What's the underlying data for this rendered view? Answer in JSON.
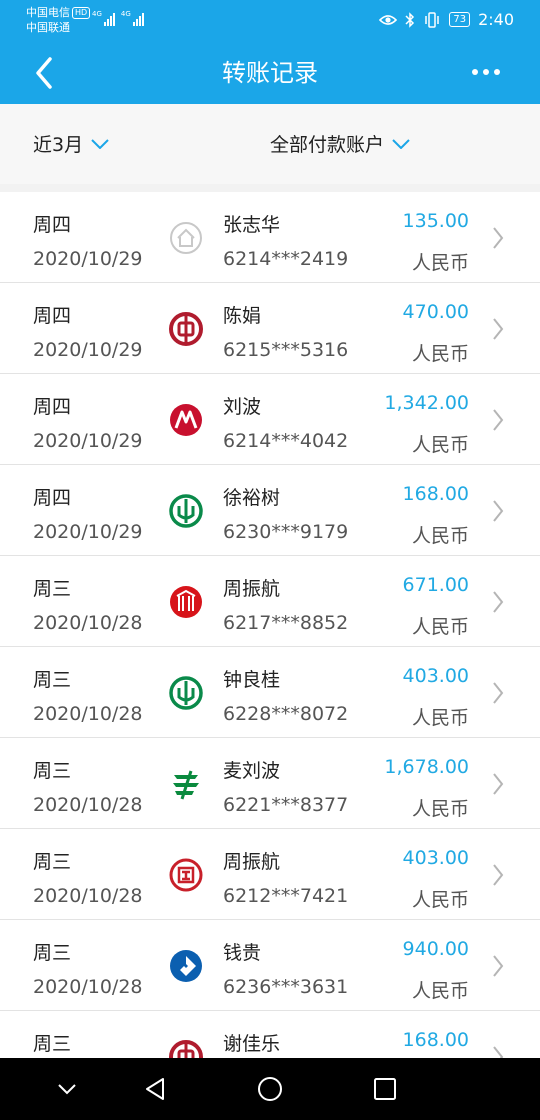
{
  "status_bar": {
    "carrier_1": "中国电信",
    "carrier_1_badge": "HD",
    "carrier_2": "中国联通",
    "network_1": "4G",
    "network_2": "4G",
    "battery": "73",
    "time": "2:40"
  },
  "header": {
    "title": "转账记录"
  },
  "filters": {
    "period": "近3月",
    "account": "全部付款账户"
  },
  "transactions": [
    {
      "weekday": "周四",
      "date": "2020/10/29",
      "name": "张志华",
      "account": "6214***2419",
      "amount": "135.00",
      "currency": "人民币",
      "bank_icon": "house-bank-icon",
      "color": "#c8c8c8"
    },
    {
      "weekday": "周四",
      "date": "2020/10/29",
      "name": "陈娟",
      "account": "6215***5316",
      "amount": "470.00",
      "currency": "人民币",
      "bank_icon": "boc-icon",
      "color": "#b01c2e"
    },
    {
      "weekday": "周四",
      "date": "2020/10/29",
      "name": "刘波",
      "account": "6214***4042",
      "amount": "1,342.00",
      "currency": "人民币",
      "bank_icon": "cmb-icon",
      "color": "#c8102e"
    },
    {
      "weekday": "周四",
      "date": "2020/10/29",
      "name": "徐裕树",
      "account": "6230***9179",
      "amount": "168.00",
      "currency": "人民币",
      "bank_icon": "abc-icon",
      "color": "#0a8a4a"
    },
    {
      "weekday": "周三",
      "date": "2020/10/28",
      "name": "周振航",
      "account": "6217***8852",
      "amount": "671.00",
      "currency": "人民币",
      "bank_icon": "citic-icon",
      "color": "#d7141a"
    },
    {
      "weekday": "周三",
      "date": "2020/10/28",
      "name": "钟良桂",
      "account": "6228***8072",
      "amount": "403.00",
      "currency": "人民币",
      "bank_icon": "abc-icon",
      "color": "#0a8a4a"
    },
    {
      "weekday": "周三",
      "date": "2020/10/28",
      "name": "麦刘波",
      "account": "6221***8377",
      "amount": "1,678.00",
      "currency": "人民币",
      "bank_icon": "postal-icon",
      "color": "#0a8a3e"
    },
    {
      "weekday": "周三",
      "date": "2020/10/28",
      "name": "周振航",
      "account": "6212***7421",
      "amount": "403.00",
      "currency": "人民币",
      "bank_icon": "icbc-icon",
      "color": "#c8202a"
    },
    {
      "weekday": "周三",
      "date": "2020/10/28",
      "name": "钱贵",
      "account": "6236***3631",
      "amount": "940.00",
      "currency": "人民币",
      "bank_icon": "ccb-icon",
      "color": "#0b5fb0"
    },
    {
      "weekday": "周三",
      "date": "",
      "name": "谢佳乐",
      "account": "",
      "amount": "168.00",
      "currency": "",
      "bank_icon": "boc-icon",
      "color": "#b01c2e"
    }
  ],
  "colors": {
    "header_bg": "#1ba6e8",
    "amount": "#21a9e3"
  }
}
